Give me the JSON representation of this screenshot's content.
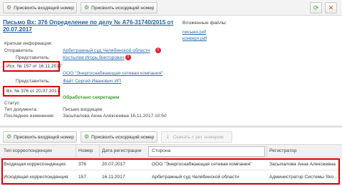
{
  "toolbar": {
    "assign_incoming": "Присвоить входящий номер",
    "assign_outgoing": "Присвоить исходящий номер"
  },
  "document": {
    "title": "Письмо Вх: 376 Определение по делу № А76-31740/2015 от 20.07.2017",
    "fields": {
      "brief_label": "Краткая информация:",
      "sender_label": "Отправитель:",
      "sender_value": "Арбитражный суд Челябинской области",
      "representative_label": "Представитель:",
      "representative_value": "Костылев Игорь Викторович",
      "outgoing_no": "Исх. № 157 от 16.11.2017",
      "recipient_value": "ООО \"Энергоснабжающая сетевая компания\"",
      "representative2_label": "Представитель:",
      "representative2_value": "Файт Сергей Иванович ИП",
      "incoming_no": "Вх. № 376 от 20.07.2017",
      "processed": "Обработано секретарем",
      "status_label": "Статус:",
      "type_label": "Тип документа:",
      "type_value": "Письмо входящее",
      "last_change_label": "Последнее изменение:",
      "last_change_value": "Засыпалова Анна Алексеевна 16.11.2017 10:50"
    }
  },
  "files": {
    "title": "Вложенные файлы:",
    "items": [
      "письмо.pdf",
      "конверт.pdf"
    ]
  },
  "toolbar2": {
    "assign_incoming": "Присвоить входящий номер",
    "assign_outgoing": "Присвоить исходящий номер",
    "download": "Скачать с рег. номером"
  },
  "table": {
    "headers": [
      "Тип корреспонденции",
      "Номер",
      "Дата регистрации",
      "Сторона",
      "Регистратор"
    ],
    "rows": [
      [
        "Входящая корреспонденция",
        "376",
        "20.07.2017",
        "ООО \"Энергоснабжающая сетевая компания\"",
        "Засыпалова Анна Алексеевна"
      ],
      [
        "Исходящая корреспонденция",
        "157",
        "16.11.2017",
        "Арбитражный суд Челябинской области",
        "Администратор Системы Sko..."
      ]
    ]
  },
  "colors": {
    "highlight": "#d40000",
    "link": "#2a6db5",
    "status_green": "#3a9a2a",
    "icon_green": "#4a9a3a"
  }
}
